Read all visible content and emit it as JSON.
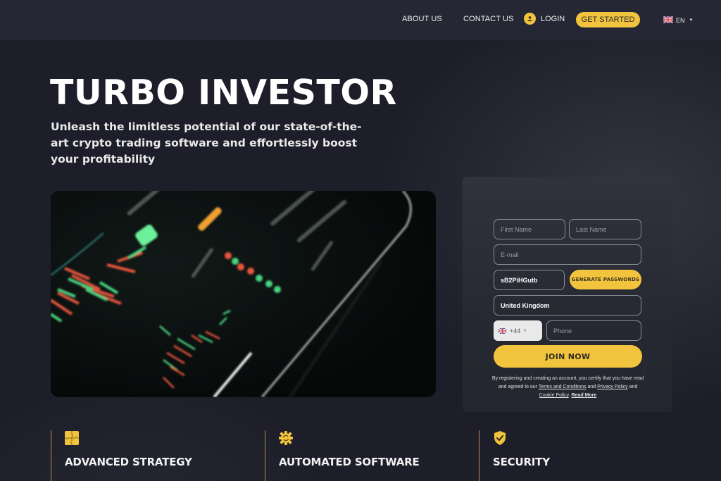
{
  "nav": {
    "about_label": "ABOUT US",
    "contact_label": "CONTACT US",
    "login_label": "LOGIN",
    "login_icon": "user-icon",
    "get_started_label": "GET STARTED",
    "language_code": "EN",
    "language_flag": "uk-flag-icon"
  },
  "hero": {
    "title": "TURBO INVESTOR",
    "subtitle": "Unleash the limitless potential of our state-of-the-art crypto trading software and effortlessly boost your profitability",
    "image_alt": "Crypto trading chart on tablet screen"
  },
  "form": {
    "first_name_placeholder": "First Name",
    "last_name_placeholder": "Last Name",
    "email_placeholder": "E-mail",
    "password_value": "sB2PiHGutb",
    "generate_label": "GENERATE PASSWORDS",
    "country_value": "United Kingdom",
    "phone_code": "+44",
    "phone_placeholder": "Phone",
    "join_label": "JOIN NOW",
    "legal": {
      "text_1": "By registering and creating an account, you certify that you have read and agreed to our ",
      "terms_label": "Terms and Conditions",
      "text_2": " and ",
      "privacy_label": "Privacy Policy",
      "text_3": " and ",
      "cookie_label": "Cookie Policy",
      "text_4": ". ",
      "read_more_label": "Read More"
    }
  },
  "features": [
    {
      "title": "ADVANCED STRATEGY",
      "icon": "puzzle-icon"
    },
    {
      "title": "AUTOMATED SOFTWARE",
      "icon": "gear-sync-icon"
    },
    {
      "title": "SECURITY",
      "icon": "shield-check-icon"
    }
  ],
  "colors": {
    "accent": "#f2c43d",
    "background": "#1d1e29",
    "header": "#252734",
    "card": "#2b2d36",
    "feature_divider": "#b8953a"
  }
}
